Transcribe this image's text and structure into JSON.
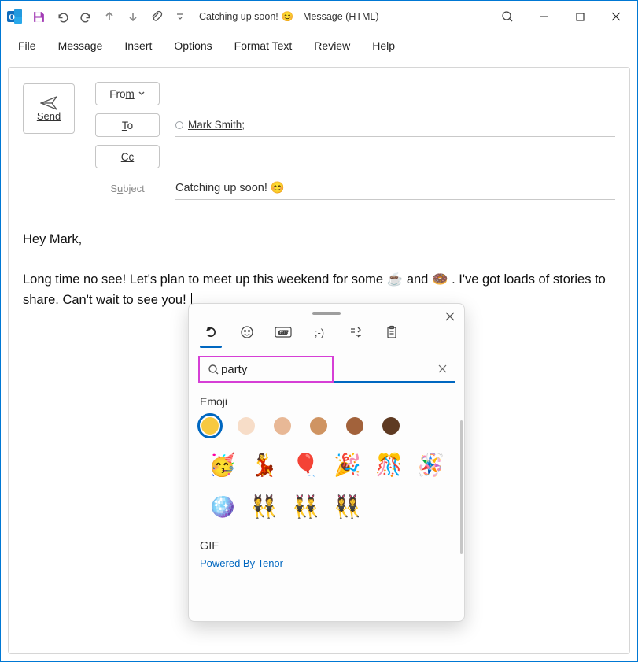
{
  "titlebar": {
    "title_before": "Catching up soon!",
    "title_emoji": "😊",
    "title_after": " -  Message (HTML)"
  },
  "menu": {
    "file": "File",
    "message": "Message",
    "insert": "Insert",
    "options": "Options",
    "format_text": "Format Text",
    "review": "Review",
    "help": "Help"
  },
  "compose": {
    "send": "Send",
    "from": "From",
    "to": "To",
    "cc": "Cc",
    "subject_label": "Subject",
    "to_recipient": "Mark Smith",
    "subject_value": "Catching up soon! 😊"
  },
  "body": {
    "greeting": "Hey Mark,",
    "line_a": "Long time no see! Let's plan to meet up this weekend for some ",
    "emoji1": "☕",
    "mid": " and ",
    "emoji2": "🍩",
    "line_b": ". I've got loads of stories to share. Can't wait to see you!"
  },
  "picker": {
    "search_value": "party",
    "section_emoji": "Emoji",
    "section_gif": "GIF",
    "powered": "Powered By Tenor",
    "skins": [
      "#f7c940",
      "#f7ddc8",
      "#e8b896",
      "#cf9462",
      "#a2623b",
      "#5e3a22"
    ],
    "grid": [
      "🥳",
      "💃",
      "🎈",
      "🎉",
      "🎊",
      "🪅",
      "🪩",
      "👯",
      "👯‍♂️",
      "👯‍♀️"
    ]
  }
}
